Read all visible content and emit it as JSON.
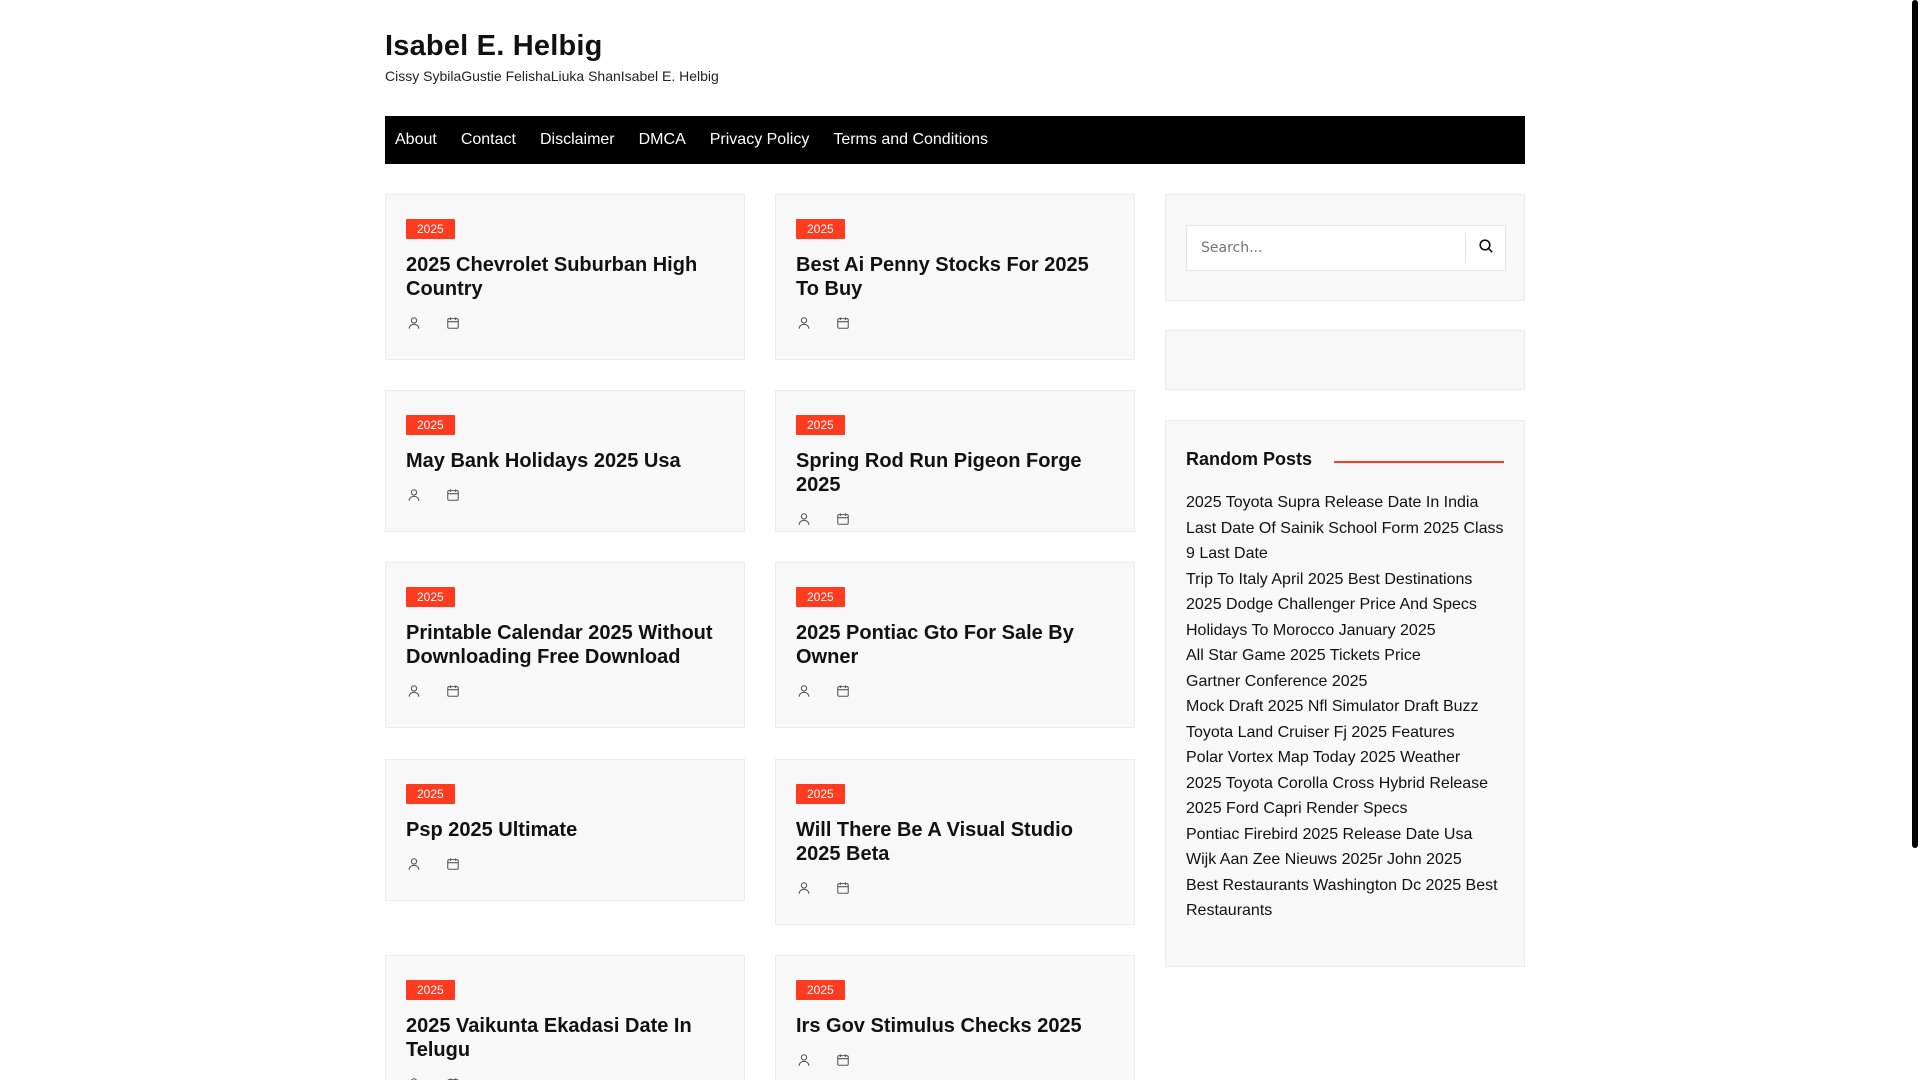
{
  "site": {
    "title": "Isabel E. Helbig",
    "description": "Cissy SybilaGustie FelishaLiuka ShanIsabel E. Helbig"
  },
  "nav": [
    "About",
    "Contact",
    "Disclaimer",
    "DMCA",
    "Privacy Policy",
    "Terms and Conditions"
  ],
  "posts": [
    {
      "category": "2025",
      "title": "2025 Chevrolet Suburban High Country"
    },
    {
      "category": "2025",
      "title": "Best Ai Penny Stocks For 2025 To Buy"
    },
    {
      "category": "2025",
      "title": "May Bank Holidays 2025 Usa"
    },
    {
      "category": "2025",
      "title": "Spring Rod Run Pigeon Forge 2025"
    },
    {
      "category": "2025",
      "title": "Printable Calendar 2025 Without Downloading Free Download"
    },
    {
      "category": "2025",
      "title": "2025 Pontiac Gto For Sale By Owner"
    },
    {
      "category": "2025",
      "title": "Psp 2025 Ultimate"
    },
    {
      "category": "2025",
      "title": "Will There Be A Visual Studio 2025 Beta"
    },
    {
      "category": "2025",
      "title": "2025 Vaikunta Ekadasi Date In Telugu"
    },
    {
      "category": "2025",
      "title": "Irs Gov Stimulus Checks 2025"
    }
  ],
  "sidebar": {
    "search_placeholder": "Search...",
    "random_posts_title": "Random Posts",
    "random_posts": [
      "2025 Toyota Supra Release Date In India",
      "Last Date Of Sainik School Form 2025 Class 9 Last Date",
      "Trip To Italy April 2025 Best Destinations",
      "2025 Dodge Challenger Price And Specs",
      "Holidays To Morocco January 2025",
      "All Star Game 2025 Tickets Price",
      "Gartner Conference 2025",
      "Mock Draft 2025 Nfl Simulator Draft Buzz",
      "Toyota Land Cruiser Fj 2025 Features",
      "Polar Vortex Map Today 2025 Weather",
      "2025 Toyota Corolla Cross Hybrid Release",
      "2025 Ford Capri Render Specs",
      "Pontiac Firebird 2025 Release Date Usa",
      "Wijk Aan Zee Nieuws 2025r John 2025",
      "Best Restaurants Washington Dc 2025 Best Restaurants"
    ]
  },
  "icons": [
    "user-icon",
    "calendar-icon",
    "search-icon"
  ],
  "colors": {
    "accent": "#ff3b1f",
    "nav_bg": "#000000",
    "card_bg": "#f8f8f8"
  }
}
